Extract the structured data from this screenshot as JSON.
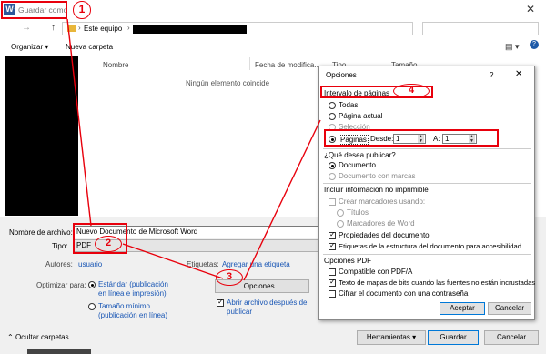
{
  "window": {
    "title": "Guardar como",
    "app_icon": "W",
    "close_glyph": "✕"
  },
  "nav": {
    "back": "←",
    "forward": "→",
    "up": "↑",
    "address_root": "Este equipo",
    "chevron": "›"
  },
  "toolbar": {
    "organize": "Organizar ▾",
    "new_folder": "Nueva carpeta",
    "help": "?"
  },
  "file_list": {
    "columns": [
      "Nombre",
      "Fecha de modifica...",
      "Tipo",
      "Tamaño"
    ],
    "empty_message": "Ningún elemento coincide"
  },
  "save_form": {
    "filename_label": "Nombre de archivo:",
    "filename_value": "Nuevo Documento de Microsoft Word",
    "type_label": "Tipo:",
    "type_value": "PDF",
    "authors_label": "Autores:",
    "authors_value": "usuario",
    "tags_label": "Etiquetas:",
    "tags_value": "Agregar una etiqueta",
    "optimize_label": "Optimizar para:",
    "optimize_standard": [
      "Estándar (publicación",
      "en línea e impresión)"
    ],
    "optimize_min": [
      "Tamaño mínimo",
      "(publicación en línea)"
    ],
    "options_button": "Opciones...",
    "open_after": [
      "Abrir archivo después de",
      "publicar"
    ],
    "hide_folders": "Ocultar carpetas",
    "tools_button": "Herramientas",
    "save_button": "Guardar",
    "cancel_button": "Cancelar"
  },
  "options_dialog": {
    "title": "Opciones",
    "help": "?",
    "close": "✕",
    "range_header": "Intervalo de páginas",
    "range_all": "Todas",
    "range_current": "Página actual",
    "range_selection": "Selección",
    "range_pages": "Páginas",
    "from_label": "Desde:",
    "from_value": "1",
    "to_label": "A:",
    "to_value": "1",
    "publish_header": "¿Qué desea publicar?",
    "publish_document": "Documento",
    "publish_markup": "Documento con marcas",
    "nonprint_header": "Incluir información no imprimible",
    "create_bookmarks": "Crear marcadores usando:",
    "bm_titles": "Títulos",
    "bm_word": "Marcadores de Word",
    "doc_properties": "Propiedades del documento",
    "struct_tags": "Etiquetas de la estructura del documento para accesibilidad",
    "pdf_header": "Opciones PDF",
    "pdfa": "Compatible con PDF/A",
    "bitmap_text": "Texto de mapas de bits cuando las fuentes no están incrustadas",
    "encrypt": "Cifrar el documento con una contraseña",
    "ok_button": "Aceptar",
    "cancel_button": "Cancelar"
  },
  "annotations": {
    "one": "1",
    "two": "2",
    "three": "3",
    "four": "4"
  },
  "colors": {
    "annotation_red": "#e8000c",
    "link_blue": "#1a57b5",
    "word_blue": "#2b579a"
  }
}
